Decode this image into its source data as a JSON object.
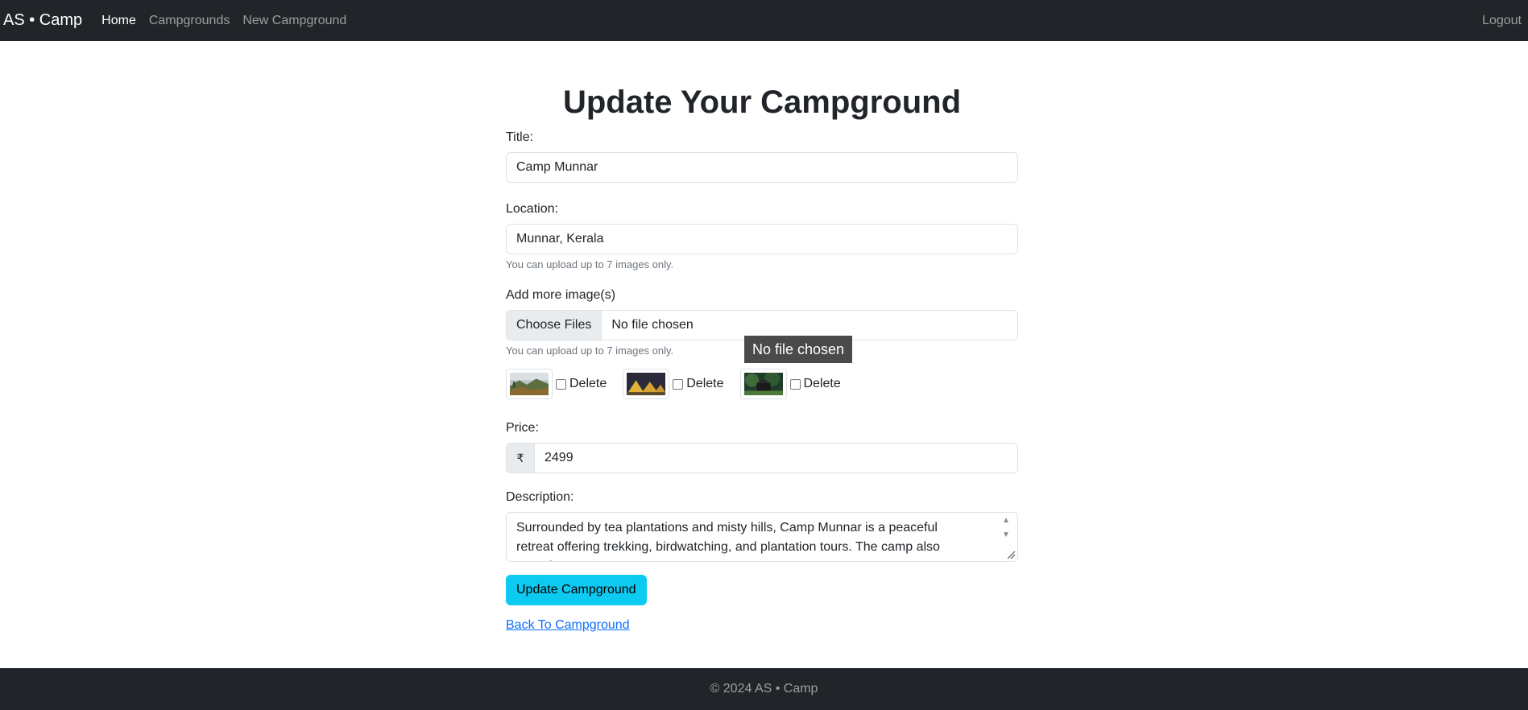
{
  "navbar": {
    "brand": "AS • Camp",
    "links": [
      {
        "label": "Home",
        "active": true
      },
      {
        "label": "Campgrounds",
        "active": false
      },
      {
        "label": "New Campground",
        "active": false
      }
    ],
    "logout": "Logout"
  },
  "form": {
    "heading": "Update Your Campground",
    "title_label": "Title:",
    "title_value": "Camp Munnar",
    "location_label": "Location:",
    "location_value": "Munnar, Kerala",
    "location_help": "You can upload up to 7 images only.",
    "images_label": "Add more image(s)",
    "file_button": "Choose Files",
    "file_status": "No file chosen",
    "images_help": "You can upload up to 7 images only.",
    "tooltip": "No file chosen",
    "existing_images": [
      {
        "delete_label": "Delete",
        "checked": false
      },
      {
        "delete_label": "Delete",
        "checked": false
      },
      {
        "delete_label": "Delete",
        "checked": false
      }
    ],
    "price_label": "Price:",
    "currency_symbol": "₹",
    "price_value": "2499",
    "description_label": "Description:",
    "description_value": "Surrounded by tea plantations and misty hills, Camp Munnar is a peaceful retreat offering trekking, birdwatching, and plantation tours. The camp also organizes",
    "submit_label": "Update Campground",
    "back_link": "Back To Campground"
  },
  "footer": {
    "text": "© 2024 AS • Camp"
  },
  "colors": {
    "navbar_bg": "#212529",
    "submit_bg": "#0dcaf0",
    "link": "#0d6efd"
  }
}
